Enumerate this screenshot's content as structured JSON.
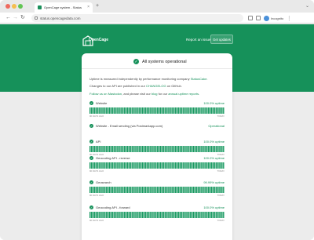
{
  "browser": {
    "tab_title": "OpenCage system - Status",
    "tab_close": "×",
    "new_tab": "+",
    "tab_menu": "⌄",
    "url": "status.opencagedata.com",
    "profile_label": "Incognito",
    "menu_glyph": "⋮",
    "back_glyph": "←",
    "forward_glyph": "→",
    "reload_glyph": "↻"
  },
  "header": {
    "logo_text": "OpenCage",
    "report_link": "Report an issue",
    "updates_button": "Get updates"
  },
  "status": {
    "check": "✓",
    "text": "All systems operational"
  },
  "intro": {
    "line1_prefix": "Uptime is measured independently by performance monitoring company ",
    "line1_link": "StatusCake",
    "line1_suffix": ".",
    "line2_prefix": "Changes to our API are published in our ",
    "line2_link": "CHANGELOG",
    "line2_suffix": " on GitHub.",
    "line3_link1": "Follow us on Mastodon",
    "line3_middle": ", and please visit our ",
    "line3_link2": "blog",
    "line3_middle2": " for our ",
    "line3_link3": "annual uptime reports",
    "line3_suffix": "."
  },
  "services": [
    {
      "name": "Website",
      "uptime": "100.0% uptime",
      "has_bars": true,
      "foot_left": "90 DAYS AGO",
      "foot_right": "TODAY"
    },
    {
      "name": "Website - Email sending (via Postmarkapp.com)",
      "uptime": "Operational",
      "has_bars": false,
      "foot_left": "",
      "foot_right": ""
    },
    {
      "name": "API",
      "uptime": "100.0% uptime",
      "has_bars": true,
      "foot_left": "90 DAYS AGO",
      "foot_right": "TODAY"
    },
    {
      "name": "Geocoding API - reverse",
      "uptime": "100.0% uptime",
      "has_bars": true,
      "foot_left": "90 DAYS AGO",
      "foot_right": "TODAY"
    },
    {
      "name": "Geosearch",
      "uptime": "99.99% uptime",
      "has_bars": true,
      "foot_left": "90 DAYS AGO",
      "foot_right": "TODAY"
    },
    {
      "name": "Geocoding API - forward",
      "uptime": "100.0% uptime",
      "has_bars": true,
      "foot_left": "90 DAYS AGO",
      "foot_right": "TODAY"
    }
  ],
  "bar_days": 90,
  "colors": {
    "brand": "#16915a",
    "bar": "#1a9a62"
  }
}
